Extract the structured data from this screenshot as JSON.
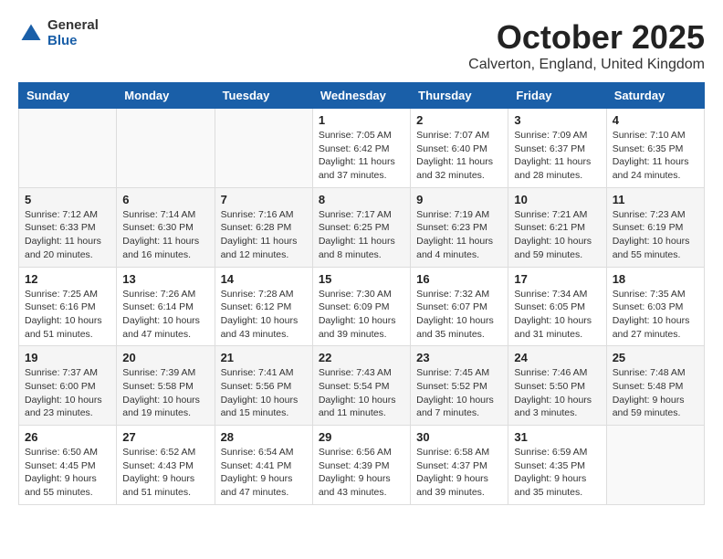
{
  "header": {
    "logo_general": "General",
    "logo_blue": "Blue",
    "month_title": "October 2025",
    "location": "Calverton, England, United Kingdom"
  },
  "days_of_week": [
    "Sunday",
    "Monday",
    "Tuesday",
    "Wednesday",
    "Thursday",
    "Friday",
    "Saturday"
  ],
  "weeks": [
    [
      {
        "day": "",
        "info": ""
      },
      {
        "day": "",
        "info": ""
      },
      {
        "day": "",
        "info": ""
      },
      {
        "day": "1",
        "info": "Sunrise: 7:05 AM\nSunset: 6:42 PM\nDaylight: 11 hours\nand 37 minutes."
      },
      {
        "day": "2",
        "info": "Sunrise: 7:07 AM\nSunset: 6:40 PM\nDaylight: 11 hours\nand 32 minutes."
      },
      {
        "day": "3",
        "info": "Sunrise: 7:09 AM\nSunset: 6:37 PM\nDaylight: 11 hours\nand 28 minutes."
      },
      {
        "day": "4",
        "info": "Sunrise: 7:10 AM\nSunset: 6:35 PM\nDaylight: 11 hours\nand 24 minutes."
      }
    ],
    [
      {
        "day": "5",
        "info": "Sunrise: 7:12 AM\nSunset: 6:33 PM\nDaylight: 11 hours\nand 20 minutes."
      },
      {
        "day": "6",
        "info": "Sunrise: 7:14 AM\nSunset: 6:30 PM\nDaylight: 11 hours\nand 16 minutes."
      },
      {
        "day": "7",
        "info": "Sunrise: 7:16 AM\nSunset: 6:28 PM\nDaylight: 11 hours\nand 12 minutes."
      },
      {
        "day": "8",
        "info": "Sunrise: 7:17 AM\nSunset: 6:25 PM\nDaylight: 11 hours\nand 8 minutes."
      },
      {
        "day": "9",
        "info": "Sunrise: 7:19 AM\nSunset: 6:23 PM\nDaylight: 11 hours\nand 4 minutes."
      },
      {
        "day": "10",
        "info": "Sunrise: 7:21 AM\nSunset: 6:21 PM\nDaylight: 10 hours\nand 59 minutes."
      },
      {
        "day": "11",
        "info": "Sunrise: 7:23 AM\nSunset: 6:19 PM\nDaylight: 10 hours\nand 55 minutes."
      }
    ],
    [
      {
        "day": "12",
        "info": "Sunrise: 7:25 AM\nSunset: 6:16 PM\nDaylight: 10 hours\nand 51 minutes."
      },
      {
        "day": "13",
        "info": "Sunrise: 7:26 AM\nSunset: 6:14 PM\nDaylight: 10 hours\nand 47 minutes."
      },
      {
        "day": "14",
        "info": "Sunrise: 7:28 AM\nSunset: 6:12 PM\nDaylight: 10 hours\nand 43 minutes."
      },
      {
        "day": "15",
        "info": "Sunrise: 7:30 AM\nSunset: 6:09 PM\nDaylight: 10 hours\nand 39 minutes."
      },
      {
        "day": "16",
        "info": "Sunrise: 7:32 AM\nSunset: 6:07 PM\nDaylight: 10 hours\nand 35 minutes."
      },
      {
        "day": "17",
        "info": "Sunrise: 7:34 AM\nSunset: 6:05 PM\nDaylight: 10 hours\nand 31 minutes."
      },
      {
        "day": "18",
        "info": "Sunrise: 7:35 AM\nSunset: 6:03 PM\nDaylight: 10 hours\nand 27 minutes."
      }
    ],
    [
      {
        "day": "19",
        "info": "Sunrise: 7:37 AM\nSunset: 6:00 PM\nDaylight: 10 hours\nand 23 minutes."
      },
      {
        "day": "20",
        "info": "Sunrise: 7:39 AM\nSunset: 5:58 PM\nDaylight: 10 hours\nand 19 minutes."
      },
      {
        "day": "21",
        "info": "Sunrise: 7:41 AM\nSunset: 5:56 PM\nDaylight: 10 hours\nand 15 minutes."
      },
      {
        "day": "22",
        "info": "Sunrise: 7:43 AM\nSunset: 5:54 PM\nDaylight: 10 hours\nand 11 minutes."
      },
      {
        "day": "23",
        "info": "Sunrise: 7:45 AM\nSunset: 5:52 PM\nDaylight: 10 hours\nand 7 minutes."
      },
      {
        "day": "24",
        "info": "Sunrise: 7:46 AM\nSunset: 5:50 PM\nDaylight: 10 hours\nand 3 minutes."
      },
      {
        "day": "25",
        "info": "Sunrise: 7:48 AM\nSunset: 5:48 PM\nDaylight: 9 hours\nand 59 minutes."
      }
    ],
    [
      {
        "day": "26",
        "info": "Sunrise: 6:50 AM\nSunset: 4:45 PM\nDaylight: 9 hours\nand 55 minutes."
      },
      {
        "day": "27",
        "info": "Sunrise: 6:52 AM\nSunset: 4:43 PM\nDaylight: 9 hours\nand 51 minutes."
      },
      {
        "day": "28",
        "info": "Sunrise: 6:54 AM\nSunset: 4:41 PM\nDaylight: 9 hours\nand 47 minutes."
      },
      {
        "day": "29",
        "info": "Sunrise: 6:56 AM\nSunset: 4:39 PM\nDaylight: 9 hours\nand 43 minutes."
      },
      {
        "day": "30",
        "info": "Sunrise: 6:58 AM\nSunset: 4:37 PM\nDaylight: 9 hours\nand 39 minutes."
      },
      {
        "day": "31",
        "info": "Sunrise: 6:59 AM\nSunset: 4:35 PM\nDaylight: 9 hours\nand 35 minutes."
      },
      {
        "day": "",
        "info": ""
      }
    ]
  ]
}
